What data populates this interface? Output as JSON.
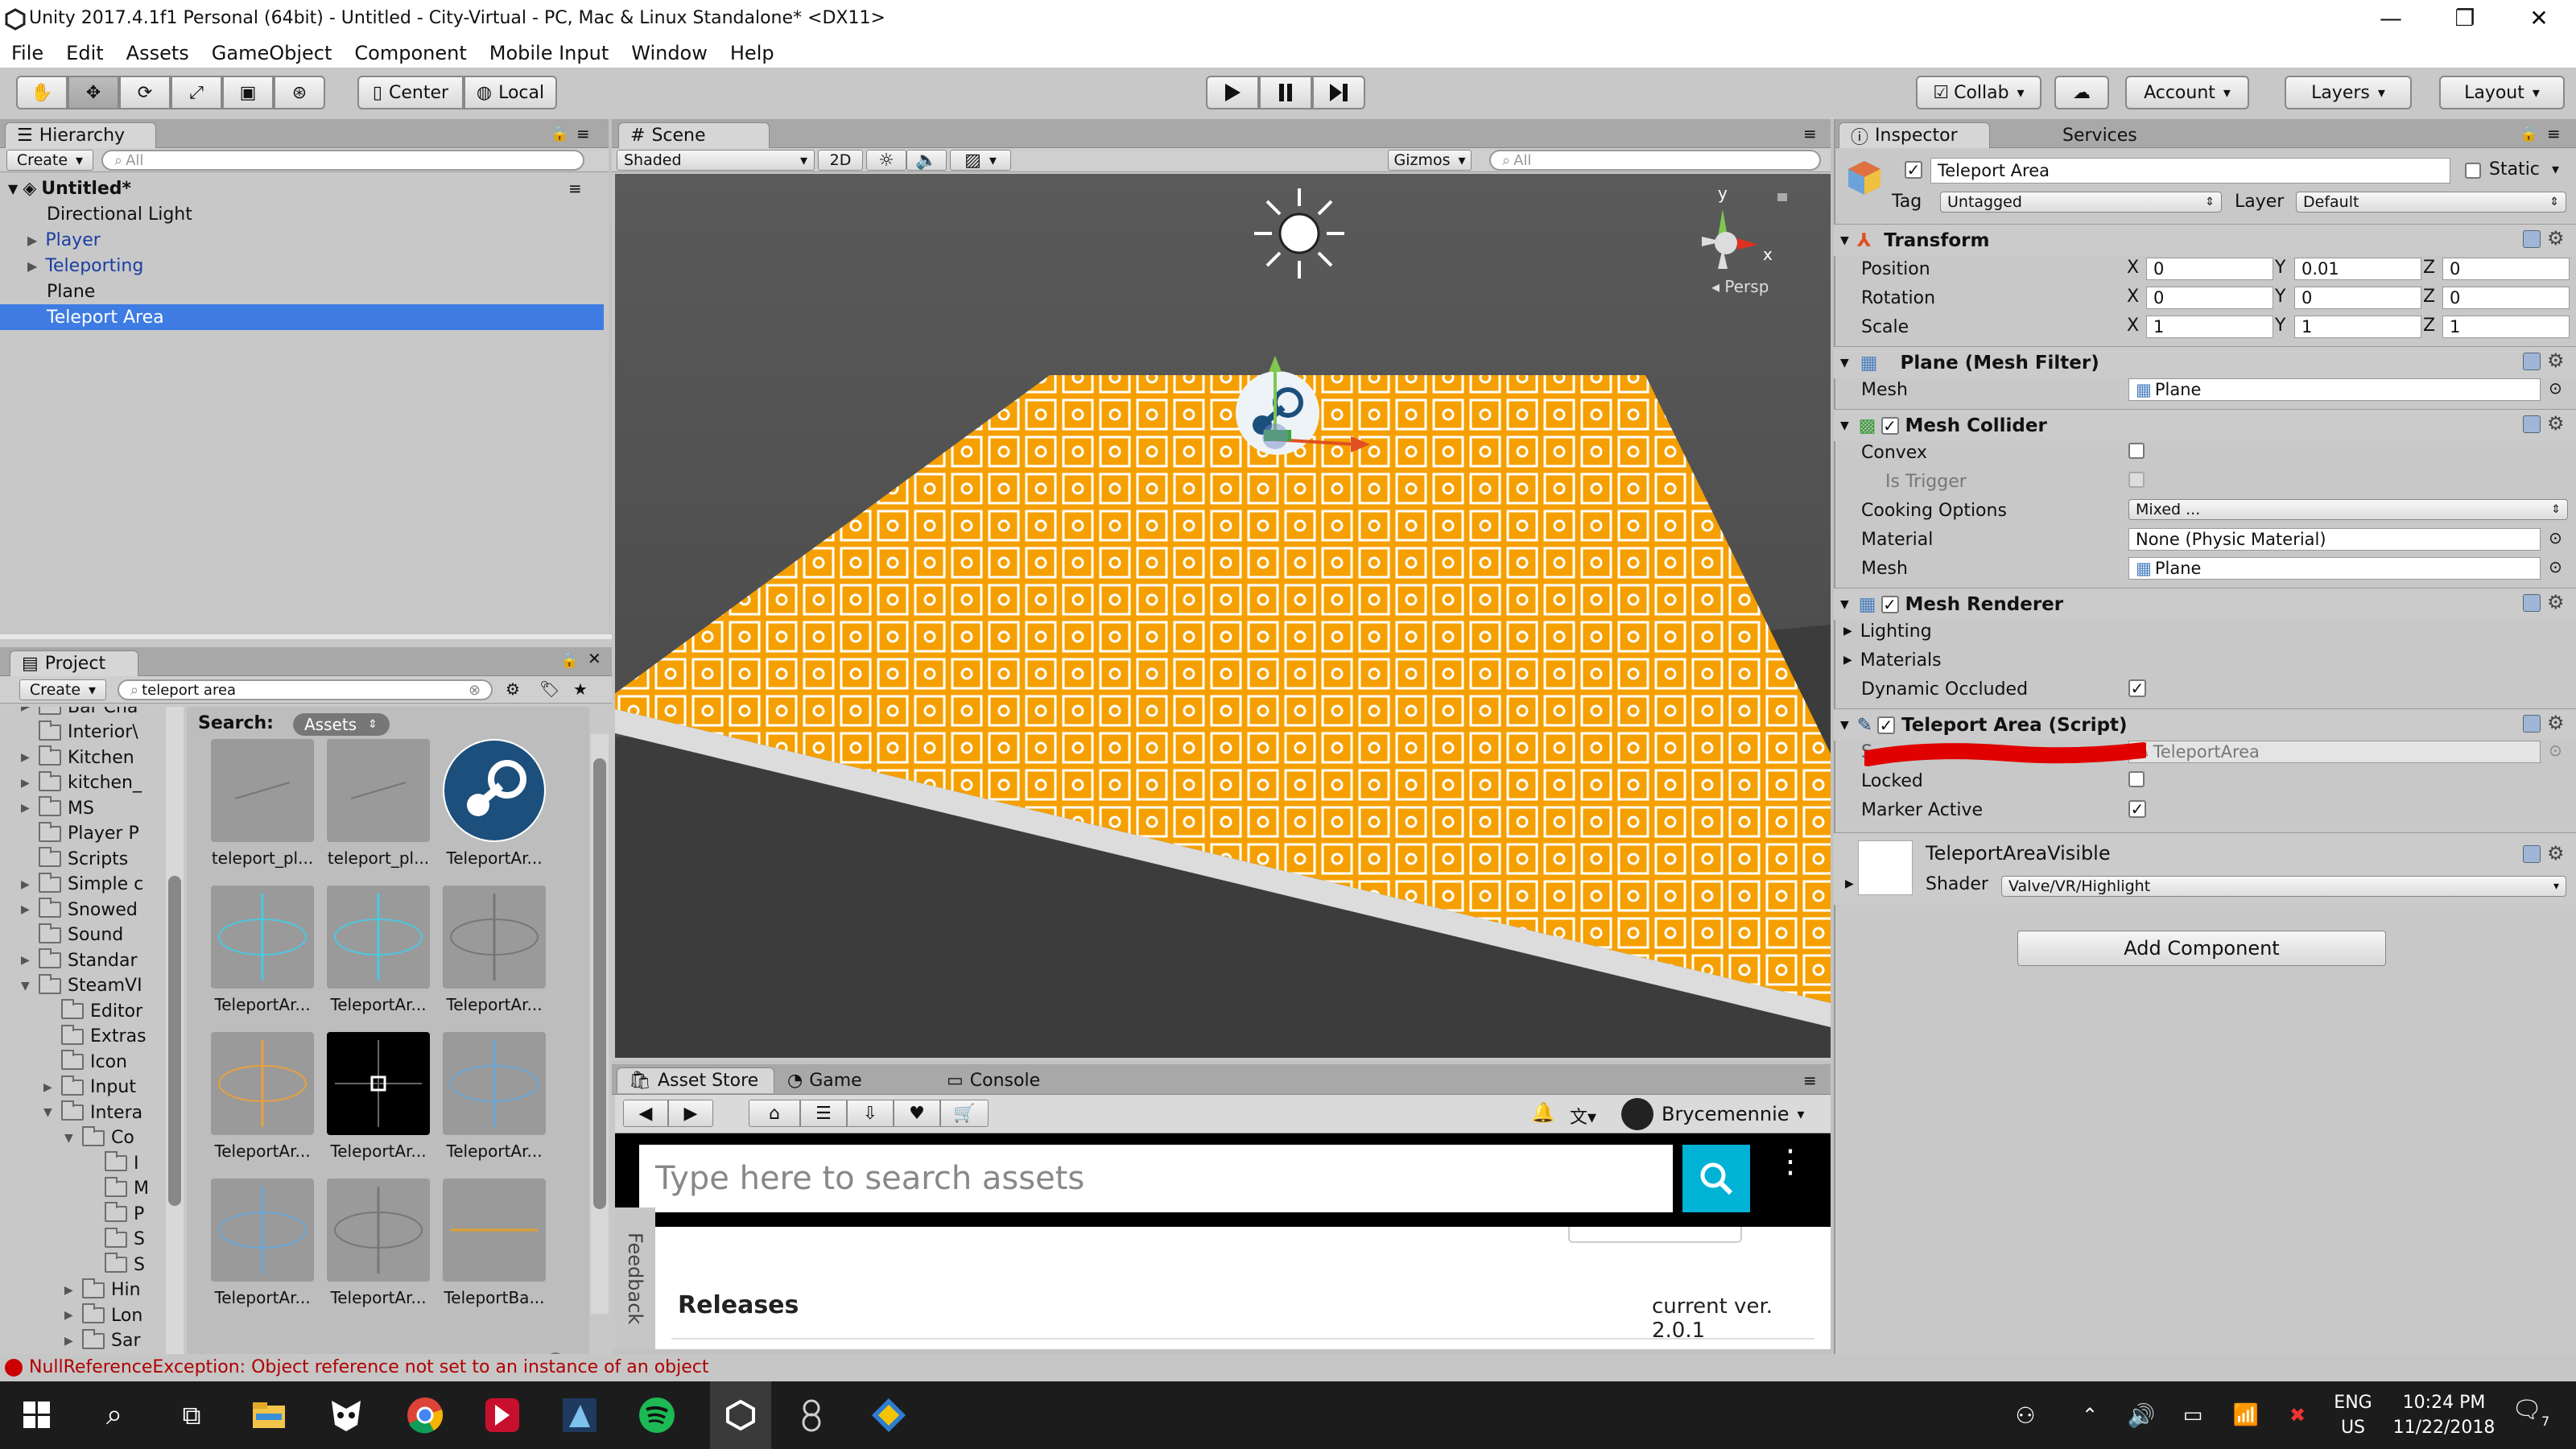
{
  "window": {
    "title": "Unity 2017.4.1f1 Personal (64bit) - Untitled - City-Virtual - PC, Mac & Linux Standalone* <DX11>",
    "minimize": "—",
    "restore": "❐",
    "close": "✕"
  },
  "menu": [
    "File",
    "Edit",
    "Assets",
    "GameObject",
    "Component",
    "Mobile Input",
    "Window",
    "Help"
  ],
  "toolbar": {
    "pivot": "Center",
    "space": "Local",
    "collab": "Collab",
    "account": "Account",
    "layers": "Layers",
    "layout": "Layout"
  },
  "hierarchy": {
    "tab": "Hierarchy",
    "create": "Create",
    "search_placeholder": "All",
    "scene": "Untitled*",
    "items": [
      {
        "label": "Directional Light"
      },
      {
        "label": "Player"
      },
      {
        "label": "Teleporting"
      },
      {
        "label": "Plane"
      },
      {
        "label": "Teleport Area"
      }
    ]
  },
  "project": {
    "tab": "Project",
    "create": "Create",
    "search_value": "teleport area",
    "search_label": "Search:",
    "scope": "Assets",
    "tree": [
      "Bar Cha",
      "Interior\\",
      "Kitchen",
      "kitchen_",
      "MS",
      "Player P",
      "Scripts",
      "Simple c",
      "Snowed",
      "Sound",
      "Standar",
      "SteamVI",
      "Editor",
      "Extras",
      "Icon",
      "Input",
      "Intera",
      "Co",
      "I",
      "M",
      "P",
      "S",
      "S",
      "Hin",
      "Lon",
      "Sar"
    ],
    "thumbs": [
      "teleport_pl...",
      "teleport_pl...",
      "TeleportAr...",
      "TeleportAr...",
      "TeleportAr...",
      "TeleportAr...",
      "TeleportAr...",
      "TeleportAr...",
      "TeleportAr...",
      "TeleportAr...",
      "TeleportAr...",
      "TeleportBa..."
    ]
  },
  "scene": {
    "tab": "Scene",
    "shading": "Shaded",
    "mode_2d": "2D",
    "gizmos": "Gizmos",
    "search_placeholder": "All",
    "persp": "Persp",
    "axis_y": "y",
    "axis_x": "x"
  },
  "bottom_tabs": {
    "asset_store": "Asset Store",
    "game": "Game",
    "console": "Console"
  },
  "asset_store": {
    "user": "Brycemennie",
    "search_placeholder": "Type here to search assets",
    "feedback": "Feedback",
    "releases": "Releases",
    "version": "current ver. 2.0.1"
  },
  "status": {
    "message": "NullReferenceException: Object reference not set to an instance of an object"
  },
  "inspector": {
    "tab": "Inspector",
    "services_tab": "Services",
    "object_name": "Teleport Area",
    "static": "Static",
    "tag_label": "Tag",
    "tag": "Untagged",
    "layer_label": "Layer",
    "layer": "Default",
    "transform": {
      "title": "Transform",
      "position_label": "Position",
      "rotation_label": "Rotation",
      "scale_label": "Scale",
      "position": {
        "x": "0",
        "y": "0.01",
        "z": "0"
      },
      "rotation": {
        "x": "0",
        "y": "0",
        "z": "0"
      },
      "scale": {
        "x": "1",
        "y": "1",
        "z": "1"
      },
      "x": "X",
      "y": "Y",
      "z": "Z"
    },
    "mesh_filter": {
      "title": "Plane (Mesh Filter)",
      "mesh_label": "Mesh",
      "mesh": "Plane"
    },
    "mesh_collider": {
      "title": "Mesh Collider",
      "convex": "Convex",
      "is_trigger": "Is Trigger",
      "cooking_label": "Cooking Options",
      "cooking": "Mixed ...",
      "material_label": "Material",
      "material": "None (Physic Material)",
      "mesh_label": "Mesh",
      "mesh": "Plane"
    },
    "mesh_renderer": {
      "title": "Mesh Renderer",
      "lighting": "Lighting",
      "materials": "Materials",
      "dynamic_occluded": "Dynamic Occluded"
    },
    "teleport_script": {
      "title": "Teleport Area (Script)",
      "script_label": "S",
      "script": "TeleportArea",
      "locked": "Locked",
      "marker_active": "Marker Active"
    },
    "material": {
      "name": "TeleportAreaVisible",
      "shader_label": "Shader",
      "shader": "Valve/VR/Highlight"
    },
    "add_component": "Add Component"
  },
  "taskbar": {
    "lang": "ENG",
    "region": "US",
    "time": "10:24 PM",
    "date": "11/22/2018",
    "notifications": "7"
  },
  "colors": {
    "selection": "#3e7ce3",
    "teleport_orange": "#f5a000",
    "asset_store_cyan": "#00b2d6",
    "redact": "#e00000"
  }
}
